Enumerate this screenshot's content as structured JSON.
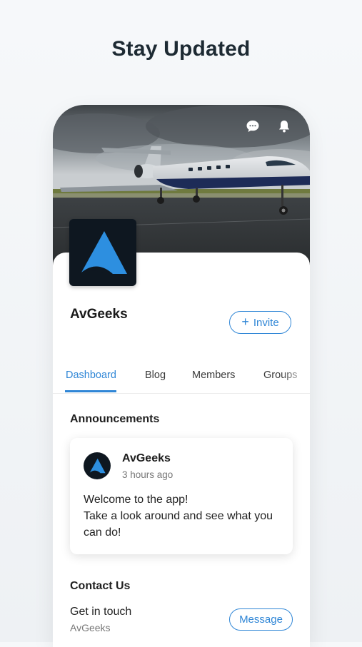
{
  "headline": "Stay Updated",
  "colors": {
    "accent": "#2f86d6",
    "logo_bg": "#0e1720",
    "logo_mark": "#2d8fe0"
  },
  "header": {
    "icons": [
      "chat-bubble-icon",
      "bell-icon"
    ]
  },
  "group": {
    "name": "AvGeeks",
    "invite_plus": "+",
    "invite_label": "Invite"
  },
  "tabs": [
    {
      "label": "Dashboard",
      "active": true
    },
    {
      "label": "Blog",
      "active": false
    },
    {
      "label": "Members",
      "active": false
    },
    {
      "label": "Groups",
      "active": false
    }
  ],
  "announcements": {
    "title": "Announcements",
    "post": {
      "author": "AvGeeks",
      "time": "3 hours ago",
      "line1": "Welcome to the app!",
      "line2": "Take a look around and see what you can do!"
    }
  },
  "contact": {
    "title": "Contact Us",
    "subtitle": "Get in touch",
    "meta": "AvGeeks",
    "button": "Message"
  }
}
